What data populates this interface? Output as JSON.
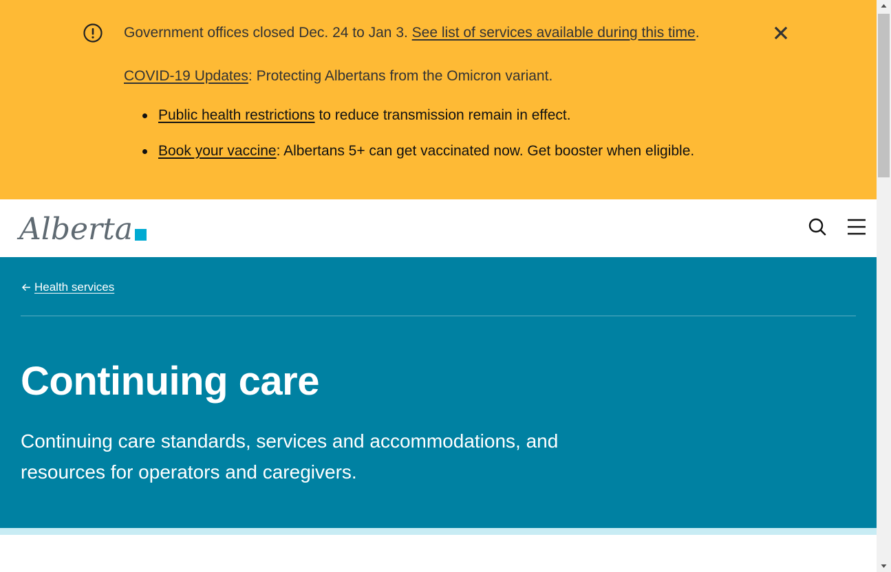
{
  "alert": {
    "closure_text": "Government offices closed Dec. 24 to Jan 3. ",
    "closure_link": "See list of services available during this time",
    "closure_end": ".",
    "covid_link": "COVID-19 Updates",
    "covid_text": ": Protecting Albertans from the Omicron variant.",
    "items": [
      {
        "link": "Public health restrictions",
        "text": " to reduce transmission remain in effect."
      },
      {
        "link": "Book your vaccine",
        "text": ": Albertans 5+ can get vaccinated now. Get booster when eligible."
      }
    ]
  },
  "header": {
    "logo_text": "Alberta"
  },
  "hero": {
    "breadcrumb": "Health services",
    "title": "Continuing care",
    "subtitle": "Continuing care standards, services and accommodations, and resources for operators and caregivers."
  },
  "icons": {
    "alert": "exclamation-circle-icon",
    "close": "close-icon",
    "search": "search-icon",
    "menu": "hamburger-menu-icon",
    "back": "arrow-left-icon"
  },
  "colors": {
    "alert_bg": "#feba35",
    "hero_bg": "#0081a2",
    "accent_bar": "#c8ecf4",
    "logo_square": "#00aad2",
    "logo_text": "#5f6a72"
  }
}
